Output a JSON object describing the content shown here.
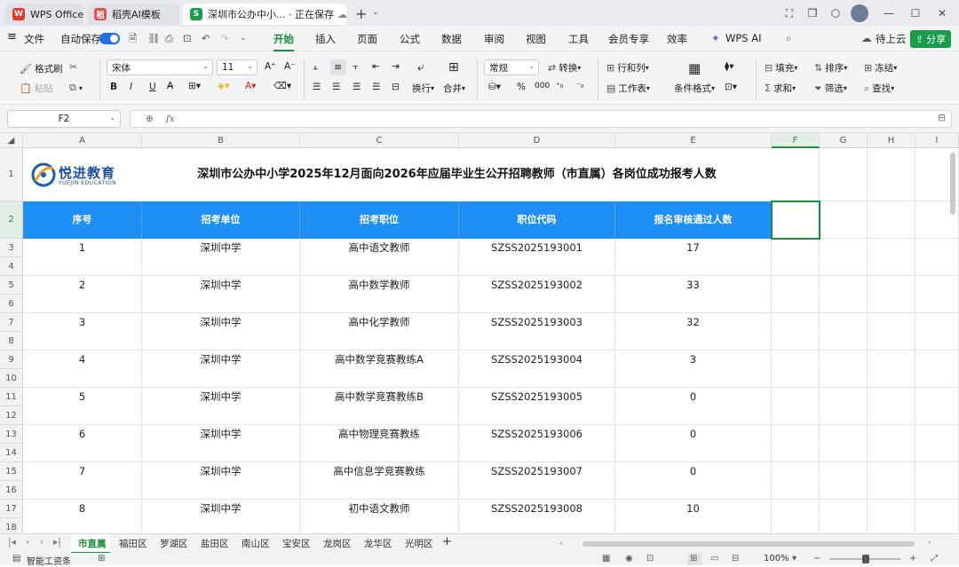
{
  "titlebar": {
    "tabs": [
      {
        "label": "WPS Office",
        "icon": "wps-logo-icon"
      },
      {
        "label": "稻壳AI模板",
        "icon": "docer-icon"
      },
      {
        "label": "深圳市公办中小... · 正在保存",
        "icon": "spreadsheet-icon"
      }
    ],
    "new_tab": "+",
    "colors": {
      "wps_red": "#e23a2f",
      "sheet_green": "#1a9d4a"
    }
  },
  "menubar": {
    "file": "文件",
    "autosave": "自动保存",
    "tabs": [
      "开始",
      "插入",
      "页面",
      "公式",
      "数据",
      "审阅",
      "视图",
      "工具",
      "会员专享",
      "效率"
    ],
    "active_tab": "开始",
    "wps_ai": "WPS AI",
    "cloud": "待上云",
    "share": "分享",
    "accent": "#1a8f3c"
  },
  "toolbar": {
    "format_painter": "格式刷",
    "paste": "粘贴",
    "font_name": "宋体",
    "font_size": "11",
    "number_format": "常规",
    "convert": "转换",
    "wrap": "换行",
    "merge": "合并",
    "row_col": "行和列",
    "worksheet": "工作表",
    "cond_format": "条件格式",
    "fill": "填充",
    "sort": "排序",
    "freeze": "冻结",
    "sum": "求和",
    "filter": "筛选",
    "find": "查找"
  },
  "formula": {
    "cell_ref": "F2",
    "fx": "fx",
    "value": ""
  },
  "sheet": {
    "columns": [
      "A",
      "B",
      "C",
      "D",
      "E",
      "F",
      "G",
      "H",
      "I"
    ],
    "rows": [
      "1",
      "2",
      "3",
      "4",
      "5",
      "6",
      "7",
      "8",
      "9",
      "10",
      "11",
      "12",
      "13",
      "14",
      "15",
      "16",
      "17",
      "18"
    ],
    "logo_text": "悦进教育",
    "logo_sub": "YUEJIN EDUCATION",
    "title": "深圳市公办中小学2025年12月面向2026年应届毕业生公开招聘教师（市直属）各岗位成功报考人数",
    "headers": [
      "序号",
      "招考单位",
      "招考职位",
      "职位代码",
      "报名审核通过人数"
    ],
    "header_color": "#1e8ff5",
    "records": [
      {
        "no": "1",
        "unit": "深圳中学",
        "position": "高中语文教师",
        "code": "SZSS2025193001",
        "count": "17"
      },
      {
        "no": "2",
        "unit": "深圳中学",
        "position": "高中数学教师",
        "code": "SZSS2025193002",
        "count": "33"
      },
      {
        "no": "3",
        "unit": "深圳中学",
        "position": "高中化学教师",
        "code": "SZSS2025193003",
        "count": "32"
      },
      {
        "no": "4",
        "unit": "深圳中学",
        "position": "高中数学竞赛教练A",
        "code": "SZSS2025193004",
        "count": "3"
      },
      {
        "no": "5",
        "unit": "深圳中学",
        "position": "高中数学竞赛教练B",
        "code": "SZSS2025193005",
        "count": "0"
      },
      {
        "no": "6",
        "unit": "深圳中学",
        "position": "高中物理竞赛教练",
        "code": "SZSS2025193006",
        "count": "0"
      },
      {
        "no": "7",
        "unit": "深圳中学",
        "position": "高中信息学竞赛教练",
        "code": "SZSS2025193007",
        "count": "0"
      },
      {
        "no": "8",
        "unit": "深圳中学",
        "position": "初中语文教师",
        "code": "SZSS2025193008",
        "count": "10"
      }
    ]
  },
  "sheet_tabs": {
    "tabs": [
      "市直属",
      "福田区",
      "罗湖区",
      "盐田区",
      "南山区",
      "宝安区",
      "龙岗区",
      "龙华区",
      "光明区"
    ],
    "active": "市直属",
    "add": "+"
  },
  "statusbar": {
    "left": "智能工资条",
    "zoom": "100%"
  }
}
